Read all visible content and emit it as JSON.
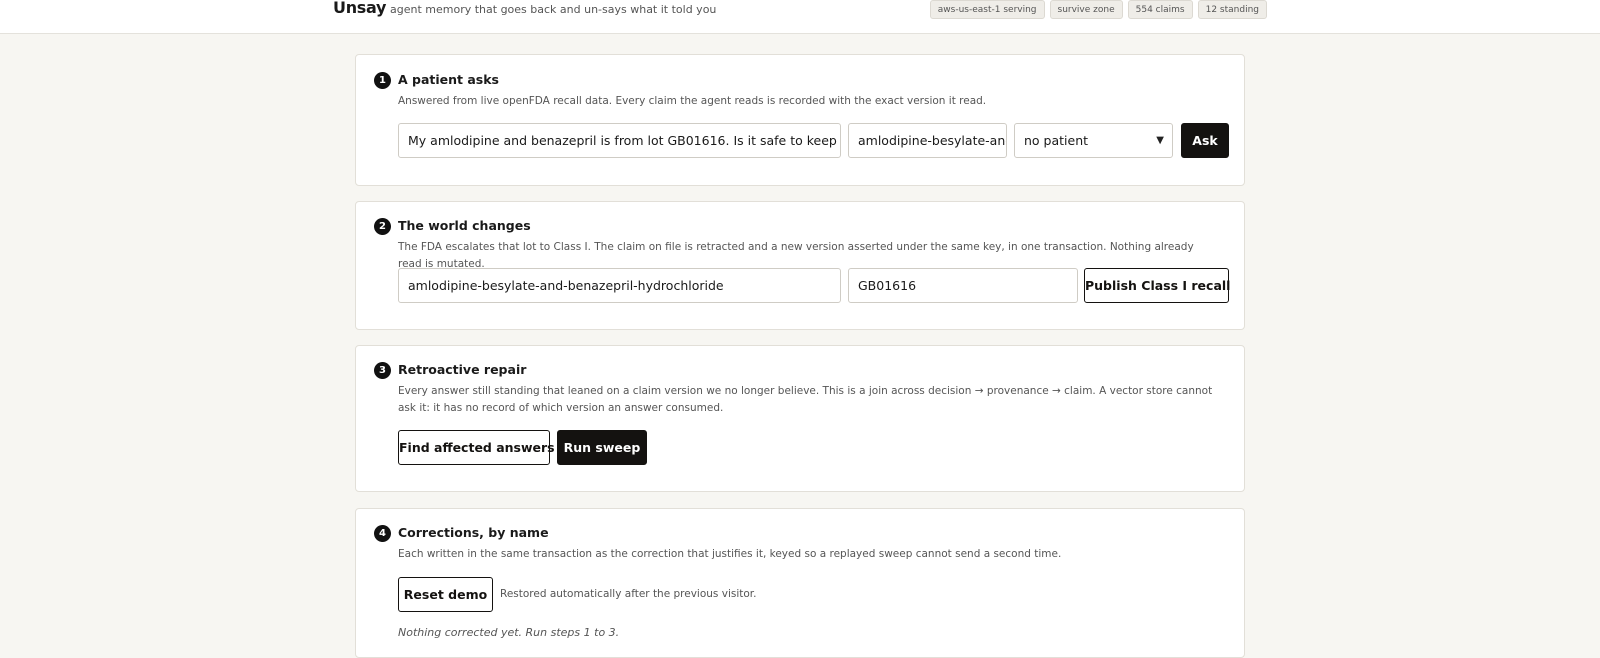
{
  "header": {
    "brand": "Unsay",
    "tagline": "agent memory that goes back and un-says what it told you",
    "badges": [
      "aws-us-east-1 serving",
      "survive zone",
      "554 claims",
      "12 standing"
    ]
  },
  "step1": {
    "number": "1",
    "title": "A patient asks",
    "description": "Answered from live openFDA recall data. Every claim the agent reads is recorded with the exact version it read.",
    "question_value": "My amlodipine and benazepril is from lot GB01616. Is it safe to keep taking it?",
    "drug_value": "amlodipine-besylate-and-benazepril-hydrochloride",
    "patient_selected": "no patient",
    "ask_label": "Ask"
  },
  "step2": {
    "number": "2",
    "title": "The world changes",
    "description": "The FDA escalates that lot to Class I. The claim on file is retracted and a new version asserted under the same key, in one transaction. Nothing already read is mutated.",
    "drug_value": "amlodipine-besylate-and-benazepril-hydrochloride",
    "lot_value": "GB01616",
    "publish_label": "Publish Class I recall"
  },
  "step3": {
    "number": "3",
    "title": "Retroactive repair",
    "description": "Every answer still standing that leaned on a claim version we no longer believe. This is a join across decision → provenance → claim. A vector store cannot ask it: it has no record of which version an answer consumed.",
    "find_label": "Find affected answers",
    "sweep_label": "Run sweep"
  },
  "step4": {
    "number": "4",
    "title": "Corrections, by name",
    "description": "Each written in the same transaction as the correction that justifies it, keyed so a replayed sweep cannot send a second time.",
    "reset_label": "Reset demo",
    "reset_note": "Restored automatically after the previous visitor.",
    "empty_text": "Nothing corrected yet. Run steps 1 to 3."
  },
  "icons": {
    "select_chevron": "chevron-down-icon"
  }
}
